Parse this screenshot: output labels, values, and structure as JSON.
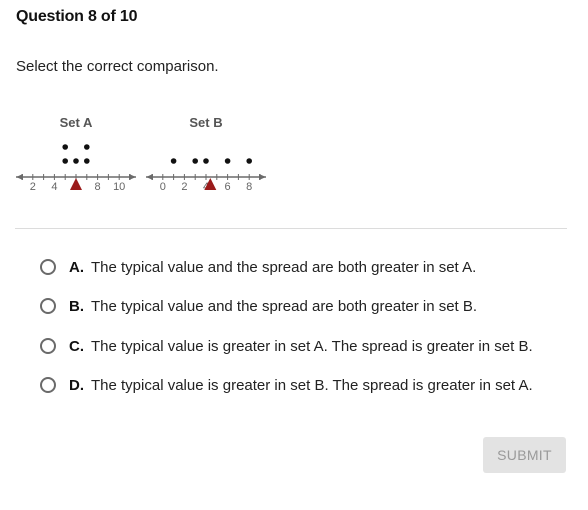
{
  "question": {
    "title": "Question 8 of 10",
    "prompt": "Select the correct comparison."
  },
  "chart_data": [
    {
      "type": "dot_plot",
      "title": "Set A",
      "x_range": [
        1,
        11
      ],
      "tick_step": 1,
      "tick_labels": [
        "2",
        "4",
        "8",
        "10"
      ],
      "tick_label_values": [
        2,
        4,
        8,
        10
      ],
      "points": [
        5,
        5,
        6,
        7,
        7
      ],
      "balance_point_marker": 6,
      "marker_color": "#9b1b1b"
    },
    {
      "type": "dot_plot",
      "title": "Set B",
      "x_range": [
        -1,
        9
      ],
      "tick_step": 1,
      "tick_labels": [
        "0",
        "2",
        "4",
        "6",
        "8"
      ],
      "tick_label_values": [
        0,
        2,
        4,
        6,
        8
      ],
      "points": [
        1,
        3,
        4,
        6,
        8
      ],
      "balance_point_marker": 4.4,
      "marker_color": "#9b1b1b"
    }
  ],
  "options": [
    {
      "letter": "A.",
      "text": "The typical value and the spread are both greater in set A."
    },
    {
      "letter": "B.",
      "text": "The typical value and the spread are both greater in set B."
    },
    {
      "letter": "C.",
      "text": "The typical value is greater in set A. The spread is greater in set B."
    },
    {
      "letter": "D.",
      "text": "The typical value is greater in set B. The spread is greater in set A."
    }
  ],
  "submit": {
    "label": "SUBMIT",
    "enabled": false
  }
}
